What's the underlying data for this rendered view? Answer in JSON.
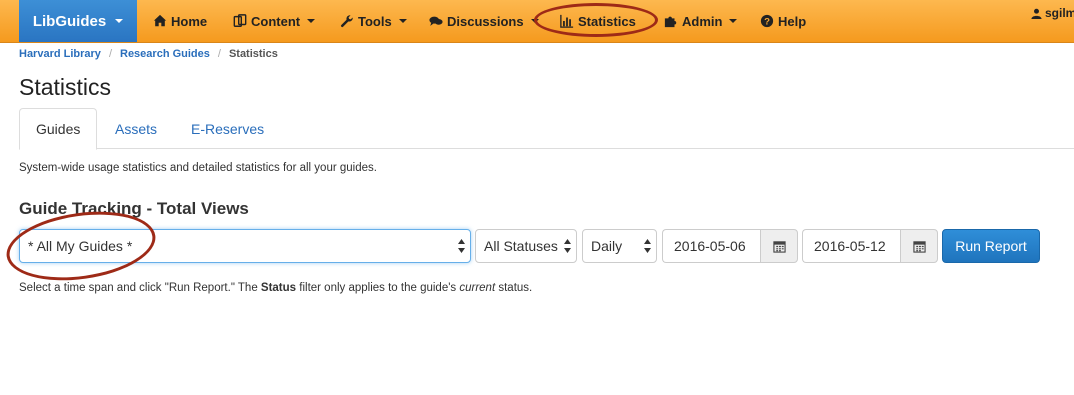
{
  "navbar": {
    "brand": "LibGuides",
    "items": [
      {
        "label": "Home",
        "icon": "home-icon"
      },
      {
        "label": "Content",
        "icon": "content-icon"
      },
      {
        "label": "Tools",
        "icon": "wrench-icon"
      },
      {
        "label": "Discussions",
        "icon": "comments-icon"
      },
      {
        "label": "Statistics",
        "icon": "bar-chart-icon"
      },
      {
        "label": "Admin",
        "icon": "puzzle-icon"
      },
      {
        "label": "Help",
        "icon": "question-icon"
      }
    ],
    "user": "sgilm"
  },
  "breadcrumb": [
    "Harvard Library",
    "Research Guides",
    "Statistics"
  ],
  "page_title": "Statistics",
  "tabs": [
    "Guides",
    "Assets",
    "E-Reserves"
  ],
  "description": "System-wide usage statistics and detailed statistics for all your guides.",
  "section_title": "Guide Tracking - Total Views",
  "controls": {
    "guide_select": "* All My Guides *",
    "status_select": "All Statuses",
    "interval_select": "Daily",
    "start_date": "2016-05-06",
    "end_date": "2016-05-12",
    "run_button": "Run Report"
  },
  "help": {
    "before": "Select a time span and click \"Run Report.\" The ",
    "bold": "Status",
    "middle": " filter only applies to the guide's ",
    "italic": "current",
    "after": " status."
  },
  "colors": {
    "navbar": "#f7a633",
    "brand": "#2f7fc9",
    "link": "#2a6ebb",
    "annotation": "#9e2a17"
  }
}
